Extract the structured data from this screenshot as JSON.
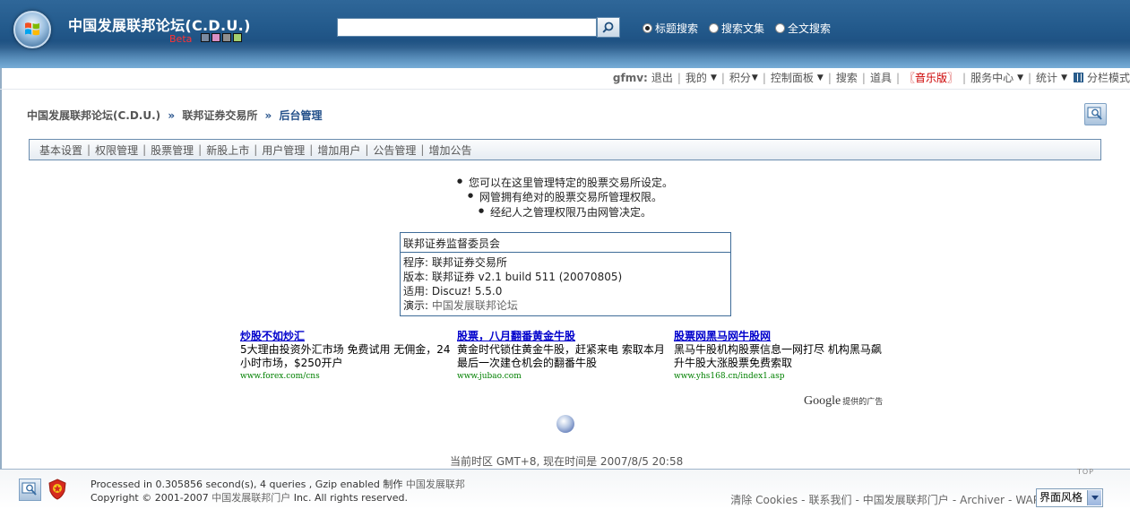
{
  "header": {
    "site_title": "中国发展联邦论坛(C.D.U.)",
    "beta_label": "Beta",
    "swatch_colors": [
      "#7a8aa0",
      "#d98fc4",
      "#8e8e8e",
      "#a4cf6e"
    ],
    "search": {
      "value": "",
      "button_icon": "search-icon"
    },
    "search_options": [
      {
        "label": "标题搜索",
        "selected": true
      },
      {
        "label": "搜索文集",
        "selected": false
      },
      {
        "label": "全文搜索",
        "selected": false
      }
    ]
  },
  "user_menu": {
    "username": "gfmv:",
    "logout": "退出",
    "items": [
      "我的",
      "积分",
      "控制面板",
      "搜索",
      "道具",
      "〖音乐版〗",
      "服务中心",
      "统计",
      "分栏模式"
    ]
  },
  "breadcrumb": {
    "root": "中国发展联邦论坛(C.D.U.)",
    "section": "联邦证券交易所",
    "current": "后台管理",
    "separator": "»"
  },
  "admin_tabs": [
    "基本设置",
    "权限管理",
    "股票管理",
    "新股上市",
    "用户管理",
    "增加用户",
    "公告管理",
    "增加公告"
  ],
  "notes": [
    "您可以在这里管理特定的股票交易所设定。",
    "网管拥有绝对的股票交易所管理权限。",
    "经纪人之管理权限乃由网管决定。"
  ],
  "infobox": {
    "header": "联邦证券监督委员会",
    "program_label": "程序: ",
    "program_value": "联邦证券交易所",
    "version_label": "版本: ",
    "version_value": "联邦证券  v2.1 build 511 (20070805)",
    "applies_label": "适用: ",
    "applies_value": "Discuz! 5.5.0",
    "demo_label": "演示: ",
    "demo_value": "中国发展联邦论坛"
  },
  "ads": [
    {
      "title": "炒股不如炒汇",
      "text": "5大理由投资外汇市场 免费试用 无佣金，24小时市场，$250开户",
      "url": "www.forex.com/cns"
    },
    {
      "title": "股票，八月翻番黄金牛股",
      "text": "黄金时代锁住黄金牛股，赶紧来电 索取本月最后一次建仓机会的翻番牛股",
      "url": "www.jubao.com"
    },
    {
      "title": "股票网黑马网牛股网",
      "text": "黑马牛股机构股票信息一网打尽 机构黑马飙升牛股大涨股票免费索取",
      "url": "www.yhs168.cn/index1.asp"
    }
  ],
  "google_credit": {
    "brand": "Google",
    "suffix": "提供的广告"
  },
  "timezone_text": "当前时区  GMT+8, 现在时间是  2007/8/5 20:58",
  "footer": {
    "processed": "Processed in 0.305856 second(s), 4 queries , Gzip enabled",
    "made_by_label": "制作",
    "made_by": "中国发展联邦",
    "copyright_prefix": "Copyright © 2001-2007",
    "copyright_owner": "中国发展联邦门户",
    "copyright_suffix": "Inc. All rights reserved.",
    "links": [
      "清除 Cookies",
      "联系我们",
      "中国发展联邦门户",
      "Archiver",
      "WAP"
    ],
    "top_label": "TOP",
    "style_select": "界面风格"
  }
}
